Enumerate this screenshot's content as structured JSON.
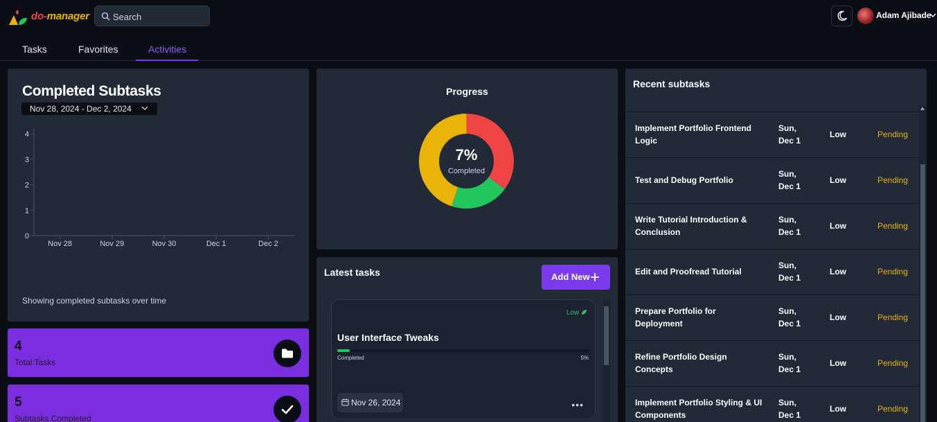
{
  "header": {
    "brand_a": "do-",
    "brand_b": "manager",
    "search_placeholder": "Search",
    "user_name": "Adam Ajibade"
  },
  "tabs": [
    {
      "label": "Tasks"
    },
    {
      "label": "Favorites"
    },
    {
      "label": "Activities",
      "active": true
    }
  ],
  "completed_subtasks": {
    "title": "Completed Subtasks",
    "date_range": "Nov 28, 2024 - Dec 2, 2024",
    "footer": "Showing completed subtasks over time",
    "chart_data": {
      "type": "bar",
      "categories": [
        "Nov 28",
        "Nov 29",
        "Nov 30",
        "Dec 1",
        "Dec 2"
      ],
      "values": [
        0,
        0,
        0,
        0,
        0
      ],
      "yticks": [
        "4",
        "3",
        "2",
        "1",
        "0"
      ],
      "ylim": [
        0,
        4
      ],
      "grid": false
    }
  },
  "stats": [
    {
      "value": "4",
      "label": "Total Tasks",
      "icon": "folder-icon"
    },
    {
      "value": "5",
      "label": "Subtasks Completed",
      "icon": "check-icon"
    }
  ],
  "progress": {
    "title": "Progress",
    "percent_label": "7%",
    "sub_label": "Completed",
    "chart_data": {
      "type": "pie",
      "segments": [
        {
          "color": "#ef4444",
          "value": 35
        },
        {
          "color": "#22c55e",
          "value": 20
        },
        {
          "color": "#eab308",
          "value": 45
        }
      ]
    }
  },
  "latest_tasks": {
    "title": "Latest tasks",
    "add_label": "Add New",
    "tasks": [
      {
        "priority": "Low",
        "title": "User Interface Tweaks",
        "progress_label": "Completed",
        "progress_text": "5%",
        "progress": 0.05,
        "date": "Nov 26, 2024"
      }
    ]
  },
  "recent_subtasks": {
    "title": "Recent subtasks",
    "rows": [
      {
        "name": "Implement Portfolio Frontend Logic",
        "day": "Sun,",
        "date": "Dec 1",
        "priority": "Low",
        "status": "Pending"
      },
      {
        "name": "Test and Debug Portfolio",
        "day": "Sun,",
        "date": "Dec 1",
        "priority": "Low",
        "status": "Pending"
      },
      {
        "name": "Write Tutorial Introduction & Conclusion",
        "day": "Sun,",
        "date": "Dec 1",
        "priority": "Low",
        "status": "Pending"
      },
      {
        "name": "Edit and Proofread Tutorial",
        "day": "Sun,",
        "date": "Dec 1",
        "priority": "Low",
        "status": "Pending"
      },
      {
        "name": "Prepare Portfolio for Deployment",
        "day": "Sun,",
        "date": "Dec 1",
        "priority": "Low",
        "status": "Pending"
      },
      {
        "name": "Refine Portfolio Design Concepts",
        "day": "Sun,",
        "date": "Dec 1",
        "priority": "Low",
        "status": "Pending"
      },
      {
        "name": "Implement Portfolio Styling & UI Components",
        "day": "Sun,",
        "date": "Dec 1",
        "priority": "Low",
        "status": "Pending"
      }
    ]
  },
  "colors": {
    "accent": "#7c3aed",
    "pending": "#eab308",
    "success": "#22c55e",
    "danger": "#ef4444"
  }
}
